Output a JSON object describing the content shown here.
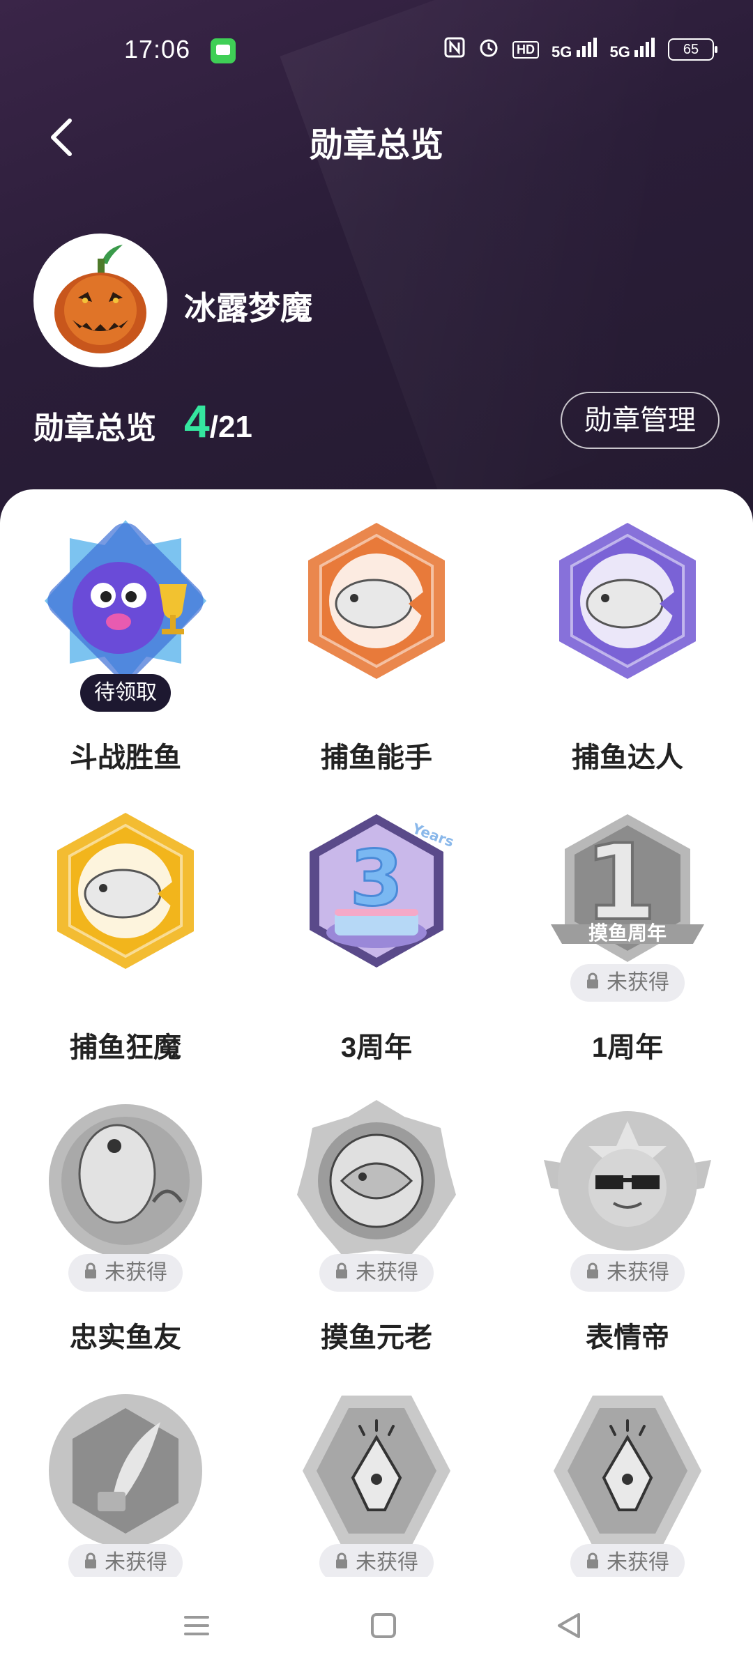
{
  "status_bar": {
    "time": "17:06",
    "network_1": "5G",
    "network_2": "5G",
    "hd": "HD",
    "battery": "65"
  },
  "header": {
    "title": "勋章总览",
    "back_icon": "chevron-left-icon"
  },
  "profile": {
    "username": "冰露梦魔",
    "overview_label": "勋章总览",
    "earned": "4",
    "total": "/21",
    "manage_label": "勋章管理"
  },
  "medals": [
    {
      "name": "斗战胜鱼",
      "status": "待领取",
      "state": "claimable",
      "color": "#4a8fe8"
    },
    {
      "name": "捕鱼能手",
      "status": "",
      "state": "earned",
      "color": "#e87a3a"
    },
    {
      "name": "捕鱼达人",
      "status": "",
      "state": "earned",
      "color": "#7a62d6"
    },
    {
      "name": "捕鱼狂魔",
      "status": "",
      "state": "earned",
      "color": "#f2b51c"
    },
    {
      "name": "3周年",
      "status": "",
      "state": "earned",
      "color": "#8a77c8"
    },
    {
      "name": "1周年",
      "status": "未获得",
      "state": "locked",
      "color": "#a9a9a9"
    },
    {
      "name": "忠实鱼友",
      "status": "未获得",
      "state": "locked",
      "color": "#a9a9a9"
    },
    {
      "name": "摸鱼元老",
      "status": "未获得",
      "state": "locked",
      "color": "#a9a9a9"
    },
    {
      "name": "表情帝",
      "status": "未获得",
      "state": "locked",
      "color": "#a9a9a9"
    },
    {
      "name": "",
      "status": "未获得",
      "state": "locked",
      "color": "#a9a9a9"
    },
    {
      "name": "",
      "status": "未获得",
      "state": "locked",
      "color": "#a9a9a9"
    },
    {
      "name": "",
      "status": "未获得",
      "state": "locked",
      "color": "#a9a9a9"
    }
  ],
  "medal_art_text": {
    "anniversary_3": "3",
    "anniversary_3_years": "Years",
    "anniversary_1": "1",
    "anniversary_1_banner": "摸鱼周年"
  },
  "nav": {
    "menu": "menu-icon",
    "home": "home-square-icon",
    "back": "back-triangle-icon"
  }
}
